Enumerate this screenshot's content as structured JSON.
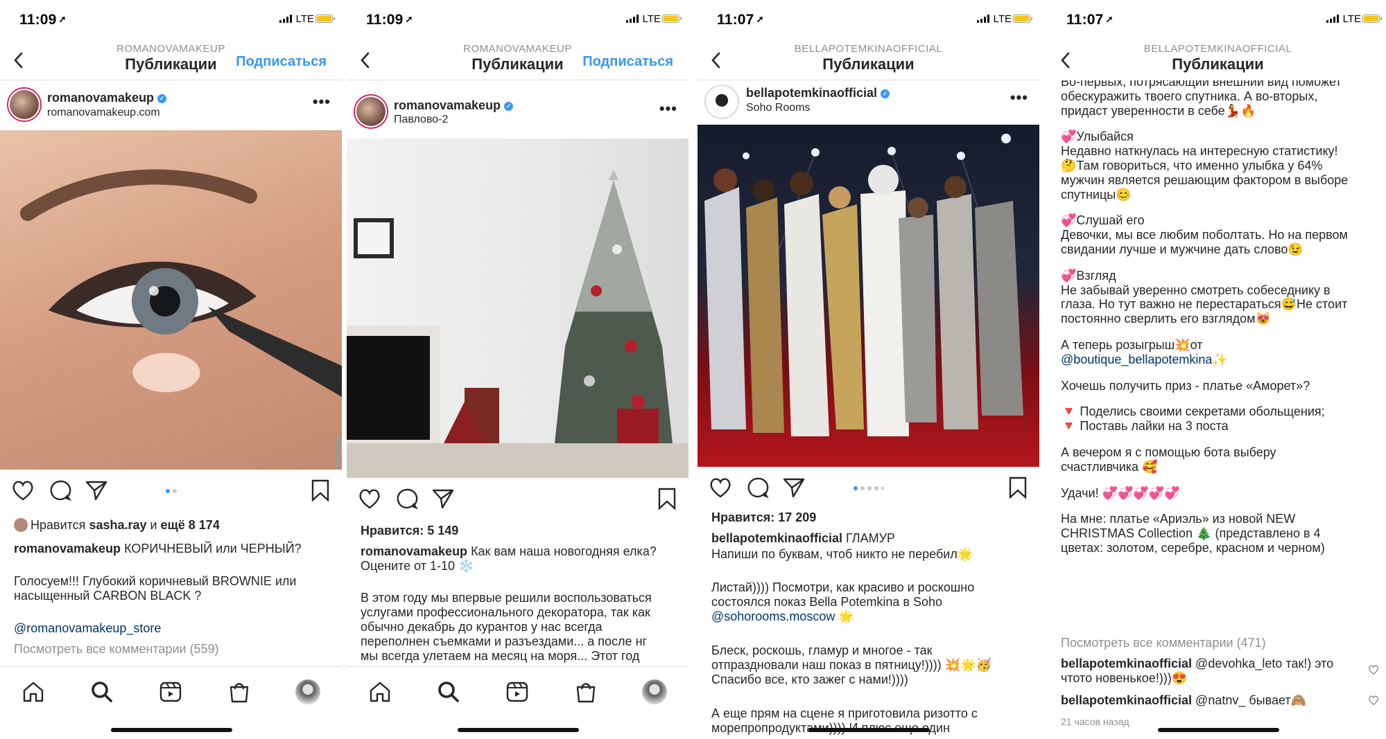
{
  "screens": [
    {
      "status": {
        "time": "11:09",
        "network": "LTE"
      },
      "nav": {
        "subtitle": "ROMANOVAMAKEUP",
        "title": "Публикации",
        "follow": "Подписаться"
      },
      "post": {
        "username": "romanovamakeup",
        "subline": "romanovamakeup.com"
      },
      "likes": {
        "prefix": "Нравится ",
        "user": "sasha.ray",
        "mid": " и ",
        "rest": "ещё 8 174"
      },
      "caption": {
        "user": "romanovamakeup",
        "text": " КОРИЧНЕВЫЙ или ЧЕРНЫЙ?"
      },
      "lines": [
        "Голосуем!!! Глубокий коричневый BROWNIE или",
        "насыщенный CARBON BLACK ?"
      ],
      "mention": "@romanovamakeup_store",
      "comments": "Посмотреть все комментарии (559)"
    },
    {
      "status": {
        "time": "11:09",
        "network": "LTE"
      },
      "nav": {
        "subtitle": "ROMANOVAMAKEUP",
        "title": "Публикации",
        "follow": "Подписаться"
      },
      "post": {
        "username": "romanovamakeup",
        "subline": "Павлово-2"
      },
      "likes": {
        "text": "Нравится: 5 149"
      },
      "caption": {
        "user": "romanovamakeup",
        "text": " Как вам наша новогодняя елка?"
      },
      "lines": [
        "Оцените от 1-10 ❄️",
        "",
        "В этом году мы впервые решили воспользоваться",
        "услугами профессионального декоратора, так как",
        "обычно декабрь до курантов у нас всегда",
        "переполнен съемками и разъездами... а после нг",
        "мы всегда улетаем на месяц на моря... Этот год"
      ]
    },
    {
      "status": {
        "time": "11:07",
        "network": "LTE"
      },
      "nav": {
        "subtitle": "BELLAPOTEMKINAOFFICIAL",
        "title": "Публикации"
      },
      "post": {
        "username": "bellapotemkinaofficial",
        "subline": "Soho Rooms"
      },
      "likes": {
        "text": "Нравится: 17 209"
      },
      "caption": {
        "user": "bellapotemkinaofficial",
        "text": " ГЛАМУР"
      },
      "lines": [
        "Напиши по буквам, чтоб никто не перебил🌟",
        "",
        "Листай)))) Посмотри, как красиво и роскошно",
        "состоялся показ Bella Potemkina в Soho",
        "@sohorooms.moscow 🌟",
        "",
        "Блеск, роскошь, гламур и многое - так",
        "отпраздновали наш показ в пятницу!)))) 💥🌟🥳",
        "Спасибо все, кто зажег с нами!))))",
        "",
        "А еще прям на сцене я приготовила ризотто с",
        "морепропродуктами)))) И плюс еще один"
      ]
    },
    {
      "status": {
        "time": "11:07",
        "network": "LTE"
      },
      "nav": {
        "subtitle": "BELLAPOTEMKINAOFFICIAL",
        "title": "Публикации"
      },
      "lines": [
        "Во-первых, потрясающий внешний вид  поможет",
        "обескуражить твоего спутника. А во-вторых,",
        "придаст уверенности в себе💃🔥",
        "",
        "💞Улыбайся",
        "Недавно наткнулась на интересную статистику!",
        "🤔Там говориться, что именно  улыбка у  64%",
        "мужчин является решающим фактором в выборе",
        "спутницы😊",
        "",
        "💞Слушай его",
        "Девочки, мы все любим поболтать. Но на первом",
        "свидании лучше и мужчине дать слово😉",
        "",
        "💞Взгляд",
        "Не забывай уверенно смотреть собеседнику в",
        "глаза. Но тут важно не перестараться😅Не стоит",
        "постоянно сверлить его взглядом😻",
        "",
        "А теперь розыгрыш💥от",
        "@boutique_bellapotemkina✨",
        "",
        "Хочешь получить приз - платье «Аморет»?",
        "",
        "🔻 Поделись своими секретами обольщения;",
        "🔻 Поставь лайки на 3 поста",
        "",
        "А вечером я с помощью бота выберу",
        "счастливчика 🥰",
        "",
        "Удачи! 💞💞💞💞💞",
        "",
        "На мне: платье «Ариэль» из новой NEW",
        "CHRISTMAS Collection 🎄 (представлено в 4",
        "цветах: золотом, серебре, красном и черном)"
      ],
      "comments": "Посмотреть все комментарии (471)",
      "comment1": {
        "user": "bellapotemkinaofficial",
        "text": " @devohka_leto так!) это",
        "text2": "чтото новенькое!)))😍"
      },
      "comment2": {
        "user": "bellapotemkinaofficial",
        "text": " @natnv_ бывает🙈"
      },
      "timeago": "21 часов назад"
    }
  ],
  "colors": {
    "accent": "#3897f0",
    "text": "#262626",
    "muted": "#8e8e8e"
  },
  "icons": [
    "back-chevron-icon",
    "more-icon",
    "heart-icon",
    "comment-icon",
    "share-icon",
    "bookmark-icon",
    "home-icon",
    "search-icon",
    "reels-icon",
    "shop-icon",
    "profile-icon"
  ]
}
